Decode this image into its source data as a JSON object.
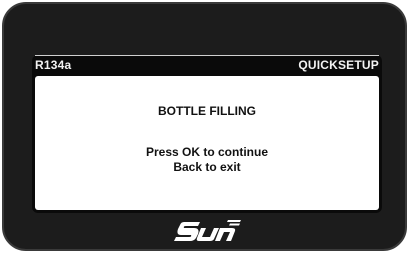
{
  "header": {
    "refrigerant": "R134a",
    "mode": "QUICKSETUP"
  },
  "dialog": {
    "title": "BOTTLE FILLING",
    "line1": "Press OK to continue",
    "line2": "Back to exit"
  },
  "brand": {
    "logo_icon": "sun-logo-icon",
    "logo_text": "SUN"
  },
  "colors": {
    "bezel": "#1c1c1c",
    "screen_background": "#0a0a0a",
    "header_text": "#f2f2f2",
    "panel_background": "#ffffff",
    "panel_text": "#111111"
  }
}
